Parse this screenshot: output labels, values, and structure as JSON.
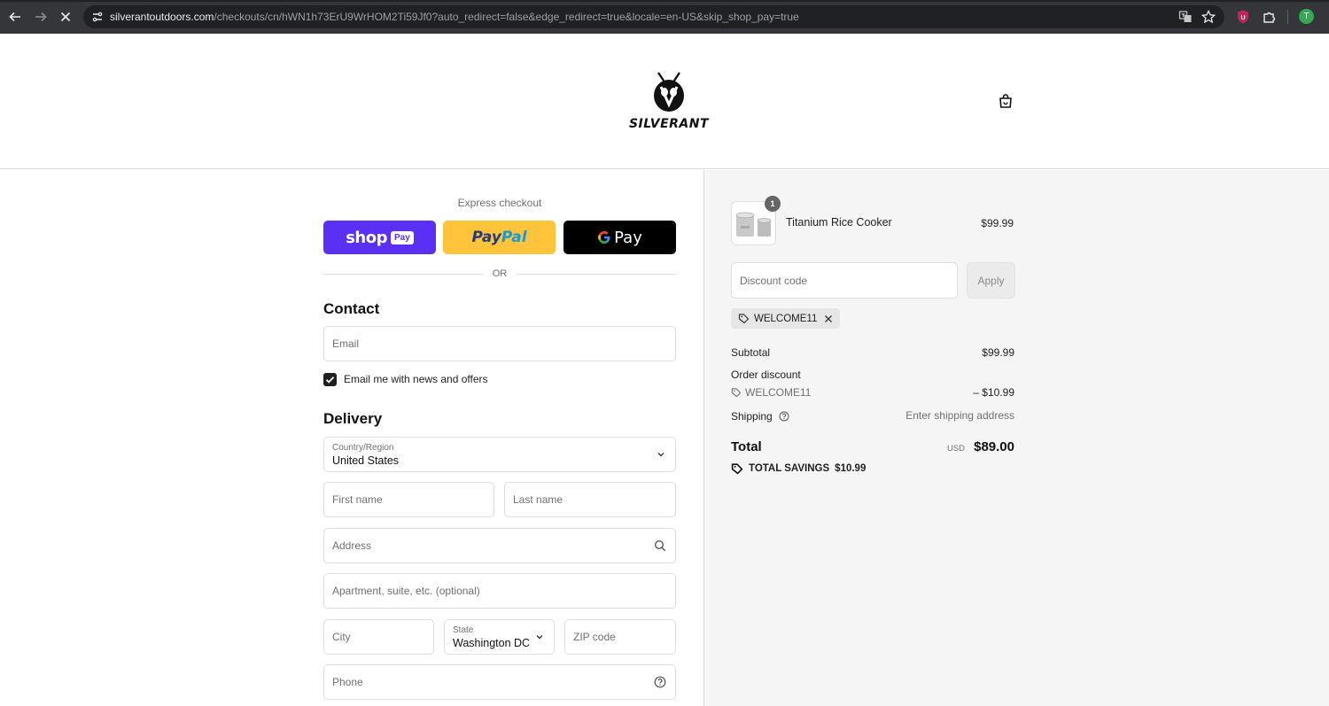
{
  "browser": {
    "url_host": "silverantoutdoors.com",
    "url_path": "/checkouts/cn/hWN1h73ErU9WrHOM2Ti59Jf0?auto_redirect=false&edge_redirect=true&locale=en-US&skip_shop_pay=true",
    "profile_initial": "T"
  },
  "header": {
    "brand": "SILVERANT"
  },
  "express": {
    "title": "Express checkout",
    "shop_pay": {
      "shop": "shop",
      "pay": "Pay"
    },
    "paypal": {
      "part1": "Pay",
      "part2": "Pal"
    },
    "gpay": {
      "g": "G",
      "pay": "Pay"
    },
    "or": "OR"
  },
  "contact": {
    "title": "Contact",
    "email_placeholder": "Email",
    "news_label": "Email me with news and offers"
  },
  "delivery": {
    "title": "Delivery",
    "country_label": "Country/Region",
    "country_value": "United States",
    "first_name_placeholder": "First name",
    "last_name_placeholder": "Last name",
    "address_placeholder": "Address",
    "apartment_placeholder": "Apartment, suite, etc. (optional)",
    "city_placeholder": "City",
    "state_label": "State",
    "state_value": "Washington DC",
    "zip_placeholder": "ZIP code",
    "phone_placeholder": "Phone"
  },
  "summary": {
    "item": {
      "name": "Titanium Rice Cooker",
      "price": "$99.99",
      "quantity": "1"
    },
    "discount_placeholder": "Discount code",
    "apply_label": "Apply",
    "applied_code": "WELCOME11",
    "subtotal_label": "Subtotal",
    "subtotal_value": "$99.99",
    "order_discount_label": "Order discount",
    "order_discount_code": "WELCOME11",
    "order_discount_value": "– $10.99",
    "shipping_label": "Shipping",
    "shipping_value": "Enter shipping address",
    "total_label": "Total",
    "total_currency": "USD",
    "total_value": "$89.00",
    "savings_label": "TOTAL SAVINGS",
    "savings_value": "$10.99"
  }
}
